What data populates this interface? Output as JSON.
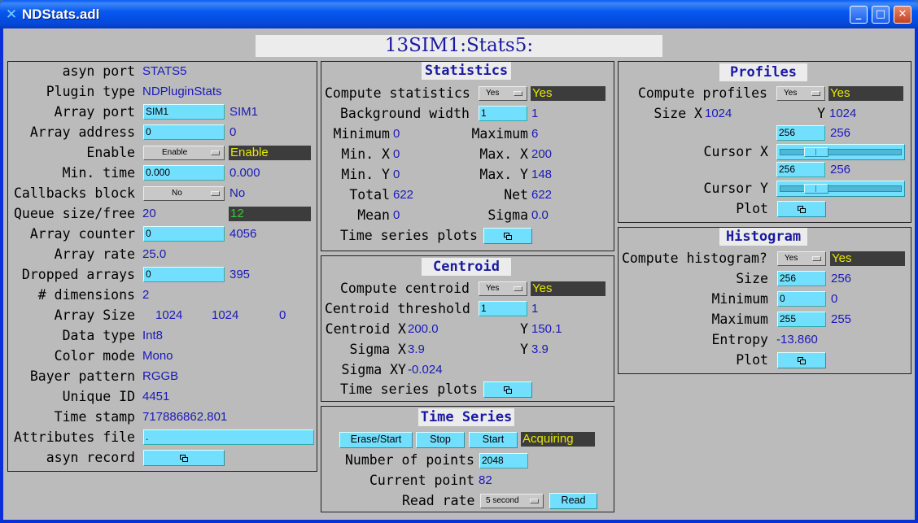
{
  "window": {
    "title": "NDStats.adl",
    "app_icon": "x-icon"
  },
  "banner": "13SIM1:Stats5:",
  "left": {
    "asyn_port_label": "asyn port",
    "asyn_port": "STATS5",
    "plugin_type_label": "Plugin type",
    "plugin_type": "NDPluginStats",
    "array_port_label": "Array port",
    "array_port_input": "SIM1",
    "array_port_readback": "SIM1",
    "array_address_label": "Array address",
    "array_address_input": "0",
    "array_address_readback": "0",
    "enable_label": "Enable",
    "enable_menu": "Enable",
    "enable_status": "Enable",
    "min_time_label": "Min. time",
    "min_time_input": "0.000",
    "min_time_readback": "0.000",
    "callbacks_block_label": "Callbacks block",
    "callbacks_block_menu": "No",
    "callbacks_block_readback": "No",
    "queue_label": "Queue size/free",
    "queue_size": "20",
    "queue_free": "12",
    "array_counter_label": "Array counter",
    "array_counter_input": "0",
    "array_counter_readback": "4056",
    "array_rate_label": "Array rate",
    "array_rate": "25.0",
    "dropped_arrays_label": "Dropped arrays",
    "dropped_arrays_input": "0",
    "dropped_arrays_readback": "395",
    "dimensions_label": "# dimensions",
    "dimensions": "2",
    "array_size_label": "Array Size",
    "array_size_x": "1024",
    "array_size_y": "1024",
    "array_size_z": "0",
    "data_type_label": "Data type",
    "data_type": "Int8",
    "color_mode_label": "Color mode",
    "color_mode": "Mono",
    "bayer_pattern_label": "Bayer pattern",
    "bayer_pattern": "RGGB",
    "unique_id_label": "Unique ID",
    "unique_id": "4451",
    "time_stamp_label": "Time stamp",
    "time_stamp": "717886862.801",
    "attributes_file_label": "Attributes file",
    "attributes_file": ".",
    "asyn_record_label": "asyn record"
  },
  "statistics": {
    "title": "Statistics",
    "compute_label": "Compute statistics",
    "compute_menu": "Yes",
    "compute_status": "Yes",
    "bg_width_label": "Background width",
    "bg_width_input": "1",
    "bg_width_readback": "1",
    "minimum_label": "Minimum",
    "minimum": "0",
    "maximum_label": "Maximum",
    "maximum": "6",
    "min_x_label": "Min. X",
    "min_x": "0",
    "max_x_label": "Max. X",
    "max_x": "200",
    "min_y_label": "Min. Y",
    "min_y": "0",
    "max_y_label": "Max. Y",
    "max_y": "148",
    "total_label": "Total",
    "total": "622",
    "net_label": "Net",
    "net": "622",
    "mean_label": "Mean",
    "mean": "0",
    "sigma_label": "Sigma",
    "sigma": "0.0",
    "ts_plots_label": "Time series plots"
  },
  "centroid": {
    "title": "Centroid",
    "compute_label": "Compute centroid",
    "compute_menu": "Yes",
    "compute_status": "Yes",
    "threshold_label": "Centroid threshold",
    "threshold_input": "1",
    "threshold_readback": "1",
    "centroid_x_label": "Centroid X",
    "centroid_x": "200.0",
    "centroid_y_label": "Y",
    "centroid_y": "150.1",
    "sigma_x_label": "Sigma X",
    "sigma_x": "3.9",
    "sigma_y_label": "Y",
    "sigma_y": "3.9",
    "sigma_xy_label": "Sigma XY",
    "sigma_xy": "-0.024",
    "ts_plots_label": "Time series plots"
  },
  "time_series": {
    "title": "Time Series",
    "erase_start": "Erase/Start",
    "stop": "Stop",
    "start": "Start",
    "status": "Acquiring",
    "num_points_label": "Number of points",
    "num_points_input": "2048",
    "current_point_label": "Current point",
    "current_point": "82",
    "read_rate_label": "Read rate",
    "read_rate_menu": "5 second",
    "read_button": "Read"
  },
  "profiles": {
    "title": "Profiles",
    "compute_label": "Compute profiles",
    "compute_menu": "Yes",
    "compute_status": "Yes",
    "size_x_label": "Size X",
    "size_x": "1024",
    "size_y_label": "Y",
    "size_y": "1024",
    "cursor_x_input": "256",
    "cursor_x_readback": "256",
    "cursor_x_label": "Cursor X",
    "cursor_x_level": 0.25,
    "cursor_y_input": "256",
    "cursor_y_readback": "256",
    "cursor_y_label": "Cursor Y",
    "cursor_y_level": 0.25,
    "plot_label": "Plot"
  },
  "histogram": {
    "title": "Histogram",
    "compute_label": "Compute histogram?",
    "compute_menu": "Yes",
    "compute_status": "Yes",
    "size_label": "Size",
    "size_input": "256",
    "size_readback": "256",
    "minimum_label": "Minimum",
    "minimum_input": "0",
    "minimum_readback": "0",
    "maximum_label": "Maximum",
    "maximum_input": "255",
    "maximum_readback": "255",
    "entropy_label": "Entropy",
    "entropy": "-13.860",
    "plot_label": "Plot"
  },
  "colors": {
    "title_bar": "#0658f0",
    "background": "#bbbbbb",
    "controller": "#73dfff",
    "readback": "#1a1ab8",
    "alarm_text": "#e8e800",
    "ok_text": "#2ed22e"
  }
}
